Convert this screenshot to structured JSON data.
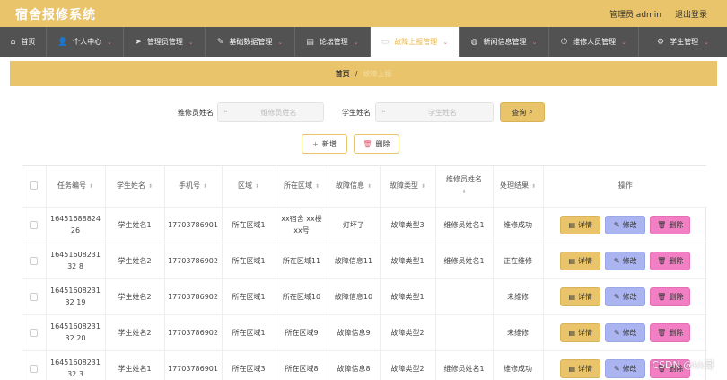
{
  "app": {
    "title": "宿舍报修系统",
    "admin_label": "管理员 admin",
    "logout_label": "退出登录"
  },
  "nav": [
    {
      "label": "首页",
      "icon": "home-icon",
      "glyph": "⌂",
      "chevron": ""
    },
    {
      "label": "个人中心",
      "icon": "user-icon",
      "glyph": "👤",
      "chevron": "⌄"
    },
    {
      "label": "管理员管理",
      "icon": "send-icon",
      "glyph": "➤",
      "chevron": "⌄"
    },
    {
      "label": "基础数据管理",
      "icon": "pen-icon",
      "glyph": "✎",
      "chevron": "⌄"
    },
    {
      "label": "论坛管理",
      "icon": "document-icon",
      "glyph": "▤",
      "chevron": "⌄"
    },
    {
      "label": "故障上报管理",
      "icon": "monitor-icon",
      "glyph": "▭",
      "chevron": "⌄"
    },
    {
      "label": "新闻信息管理",
      "icon": "globe-icon",
      "glyph": "◍",
      "chevron": "⌄"
    },
    {
      "label": "维修人员管理",
      "icon": "power-icon",
      "glyph": "⏻",
      "chevron": "⌄"
    },
    {
      "label": "学生管理",
      "icon": "gear-icon",
      "glyph": "⚙",
      "chevron": "⌄"
    }
  ],
  "breadcrumb": {
    "home": "首页",
    "separator": "/",
    "current": "故障上报"
  },
  "search": {
    "repairer_label": "维修员姓名",
    "repairer_placeholder": "维修员姓名",
    "student_label": "学生姓名",
    "student_placeholder": "学生姓名",
    "query_label": "查询"
  },
  "actions": {
    "add_label": "新增",
    "delete_label": "删除"
  },
  "table": {
    "columns": [
      {
        "label": "任务编号",
        "sortable": true
      },
      {
        "label": "学生姓名",
        "sortable": true
      },
      {
        "label": "手机号",
        "sortable": true
      },
      {
        "label": "区域",
        "sortable": true
      },
      {
        "label": "所在区域",
        "sortable": true
      },
      {
        "label": "故障信息",
        "sortable": true
      },
      {
        "label": "故障类型",
        "sortable": true
      },
      {
        "label": "维修员姓名",
        "sortable": true
      },
      {
        "label": "处理结果",
        "sortable": true
      },
      {
        "label": "操作",
        "sortable": false
      }
    ],
    "ops": {
      "detail": "详情",
      "edit": "修改",
      "delete": "删除"
    },
    "rows": [
      {
        "id": "1645168882426",
        "student": "学生姓名1",
        "phone": "17703786901",
        "region": "所在区域1",
        "location": "xx宿舍 xx楼 xx号",
        "fault": "灯坏了",
        "type": "故障类型3",
        "repairer": "维修员姓名1",
        "result": "维修成功"
      },
      {
        "id": "1645160823132 8",
        "student": "学生姓名2",
        "phone": "17703786902",
        "region": "所在区域1",
        "location": "所在区域11",
        "fault": "故障信息11",
        "type": "故障类型1",
        "repairer": "维修员姓名1",
        "result": "正在维修"
      },
      {
        "id": "1645160823132 19",
        "student": "学生姓名2",
        "phone": "17703786902",
        "region": "所在区域1",
        "location": "所在区域10",
        "fault": "故障信息10",
        "type": "故障类型1",
        "repairer": "",
        "result": "未维修"
      },
      {
        "id": "1645160823132 20",
        "student": "学生姓名2",
        "phone": "17703786902",
        "region": "所在区域1",
        "location": "所在区域9",
        "fault": "故障信息9",
        "type": "故障类型2",
        "repairer": "",
        "result": "未维修"
      },
      {
        "id": "1645160823132 3",
        "student": "学生姓名1",
        "phone": "17703786901",
        "region": "所在区域3",
        "location": "所在区域8",
        "fault": "故障信息8",
        "type": "故障类型2",
        "repairer": "维修员姓名1",
        "result": "维修成功"
      }
    ]
  },
  "watermark": "CSDN @kk哥",
  "colors": {
    "accent": "#e9c46a",
    "nav_bg": "#525252",
    "edit": "#aab4f0",
    "delete": "#f27fc4"
  }
}
